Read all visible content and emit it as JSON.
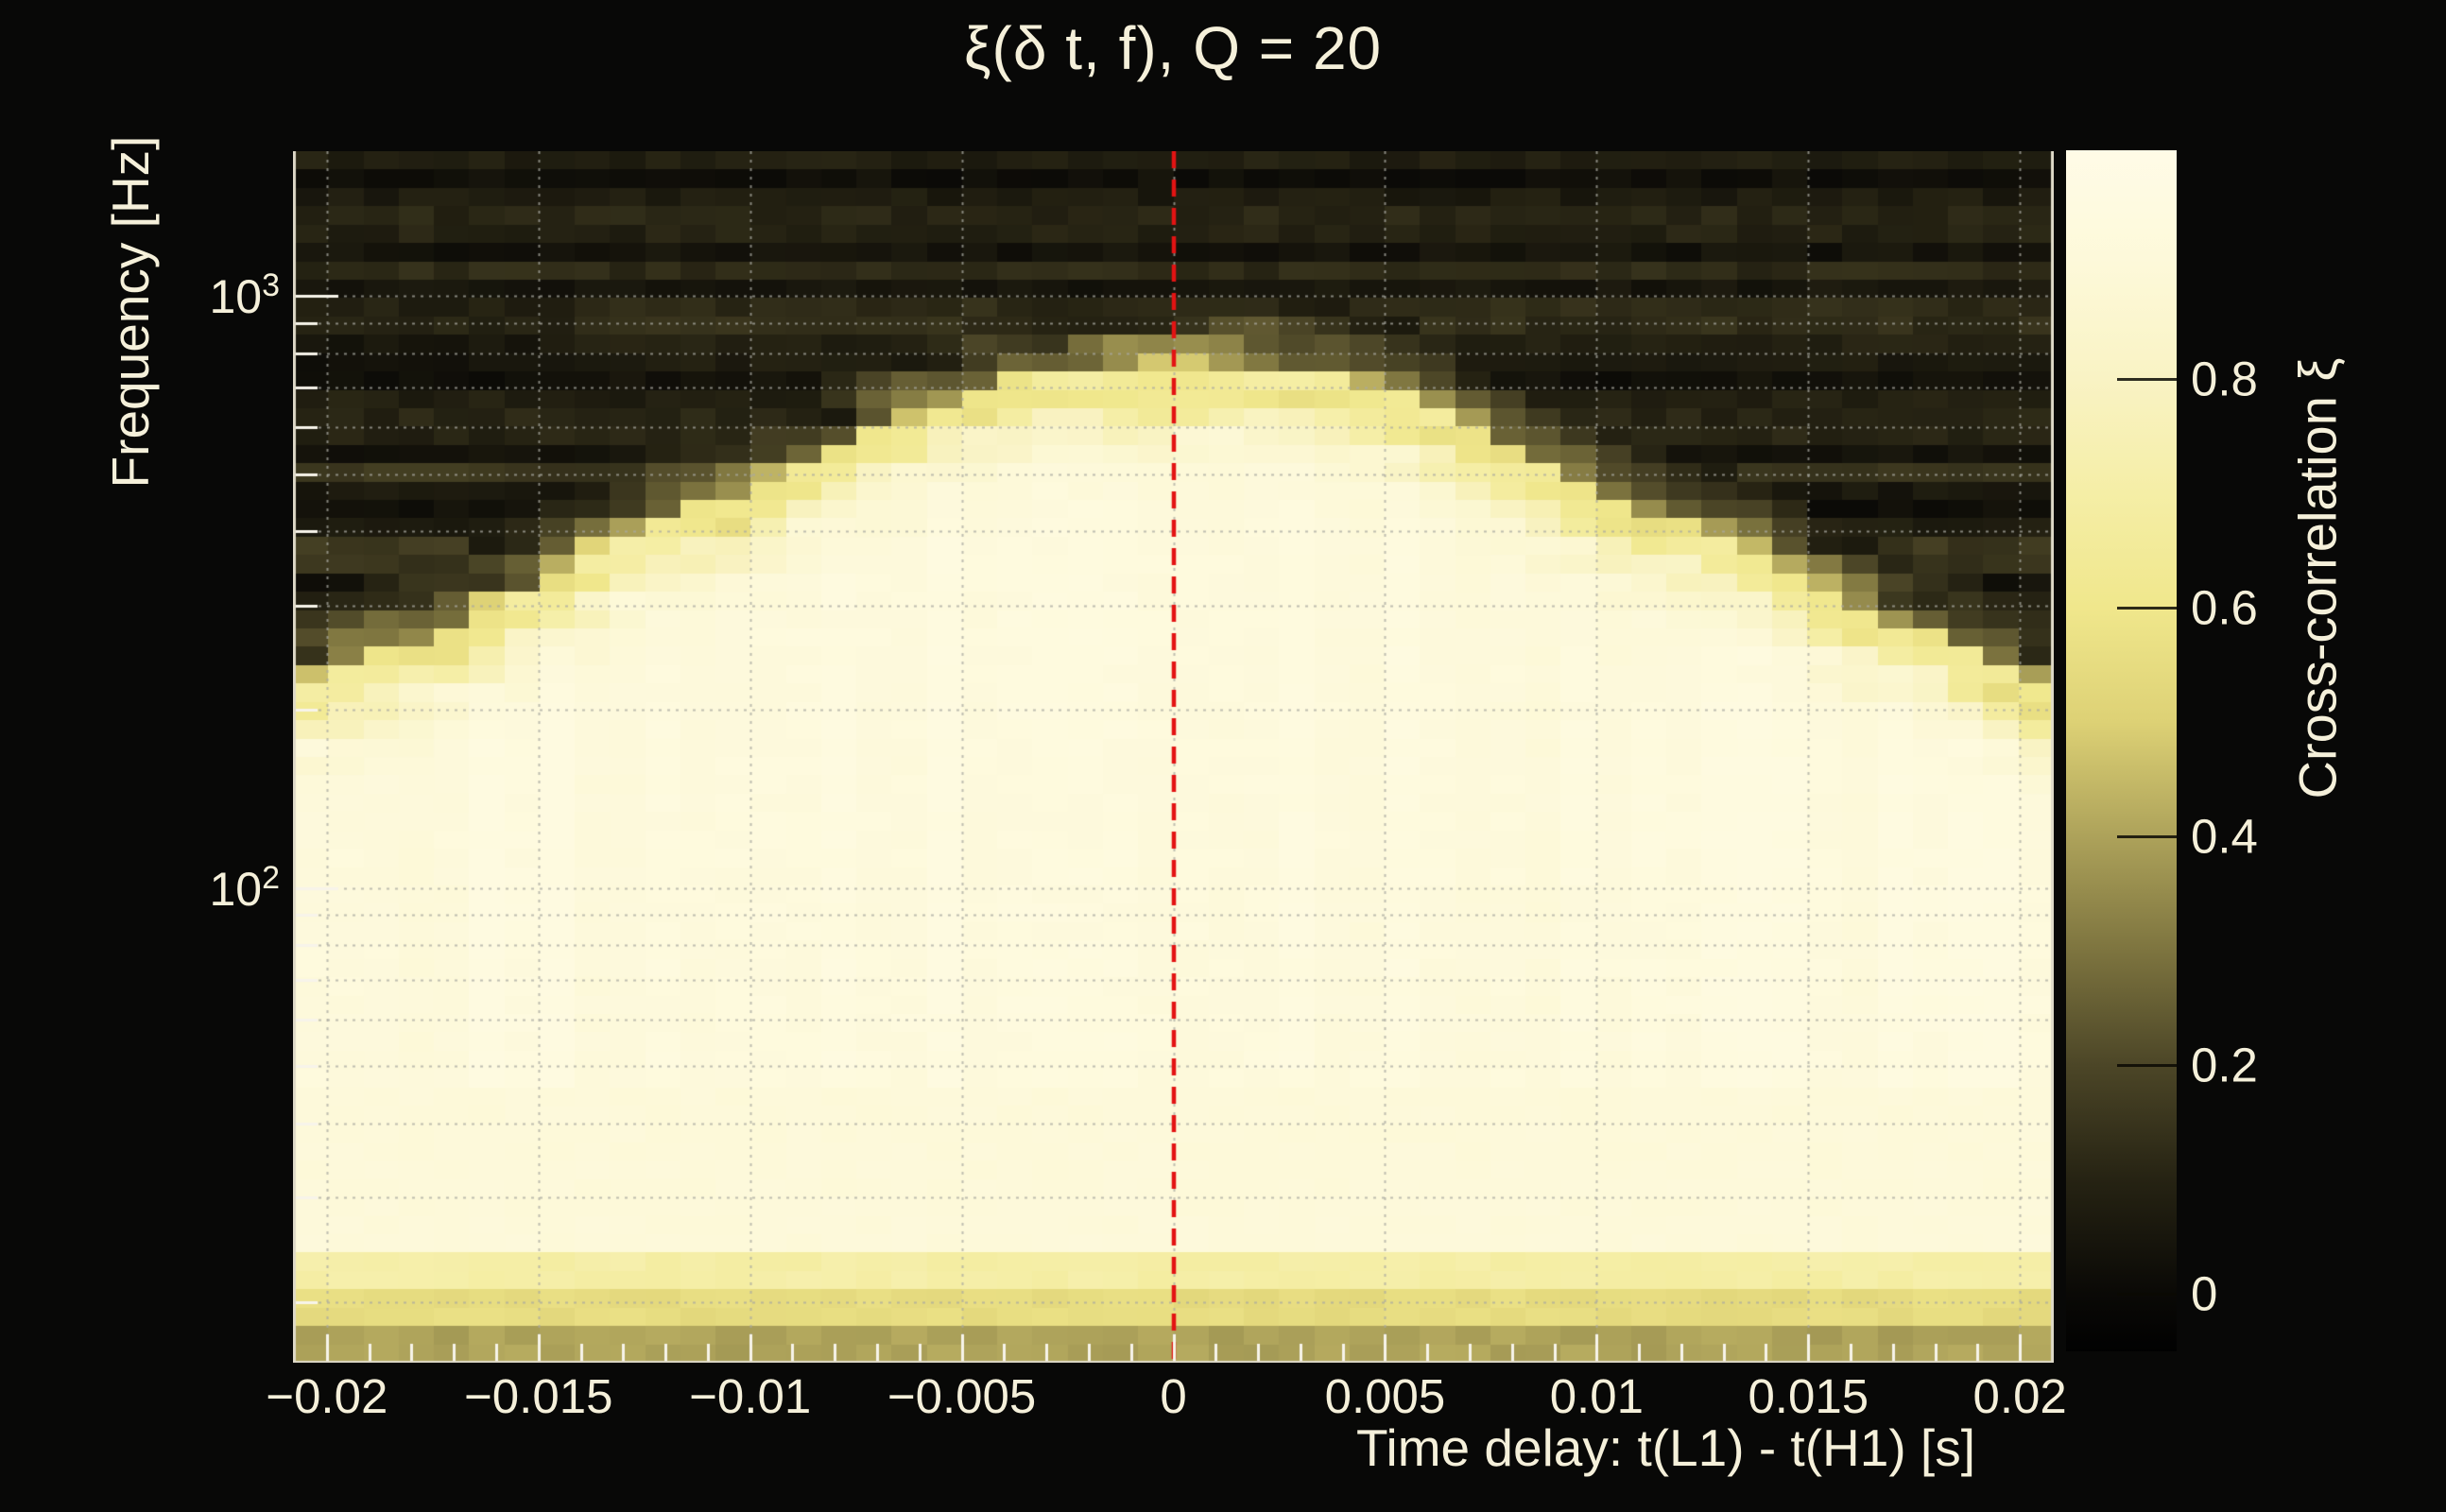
{
  "title": "ξ(δ t, f), Q = 20",
  "axes": {
    "ylabel": "Frequency [Hz]",
    "xlabel": "Time delay: t(L1) - t(H1) [s]",
    "x_ticks": [
      {
        "v": -0.02,
        "label": "−0.02"
      },
      {
        "v": -0.015,
        "label": "−0.015"
      },
      {
        "v": -0.01,
        "label": "−0.01"
      },
      {
        "v": -0.005,
        "label": "−0.005"
      },
      {
        "v": 0,
        "label": "0"
      },
      {
        "v": 0.005,
        "label": "0.005"
      },
      {
        "v": 0.01,
        "label": "0.01"
      },
      {
        "v": 0.015,
        "label": "0.015"
      },
      {
        "v": 0.02,
        "label": "0.02"
      }
    ],
    "y_ticks": [
      {
        "v": 1000,
        "base": "10",
        "exp": "3"
      },
      {
        "v": 100,
        "base": "10",
        "exp": "2"
      }
    ]
  },
  "colorbar": {
    "label": "Cross-correlation ξ",
    "vmin": -0.05,
    "vmax": 1.0,
    "ticks": [
      {
        "v": 0,
        "label": "0"
      },
      {
        "v": 0.2,
        "label": "0.2"
      },
      {
        "v": 0.4,
        "label": "0.4"
      },
      {
        "v": 0.6,
        "label": "0.6"
      },
      {
        "v": 0.8,
        "label": "0.8"
      }
    ]
  },
  "chart_data": {
    "type": "heatmap",
    "title": "ξ(δ t, f), Q = 20",
    "xlabel": "Time delay: t(L1) - t(H1) [s]",
    "ylabel": "Frequency [Hz]",
    "colorbar_label": "Cross-correlation ξ",
    "x_range_s": [
      -0.0208,
      0.0208
    ],
    "y_range_hz": [
      15.8,
      1754
    ],
    "y_scale": "log",
    "colorbar_range": [
      -0.05,
      1.0
    ],
    "colorbar_ticks": [
      0,
      0.2,
      0.4,
      0.6,
      0.8
    ],
    "x_gridlines_s": [
      -0.02,
      -0.015,
      -0.01,
      -0.005,
      0,
      0.005,
      0.01,
      0.015,
      0.02
    ],
    "y_gridlines_hz": [
      20,
      30,
      40,
      50,
      60,
      70,
      80,
      90,
      100,
      200,
      300,
      400,
      500,
      600,
      700,
      800,
      900,
      1000
    ],
    "x_minor_tick_step_s": 0.001,
    "marker_line": {
      "x_s": 0,
      "style": "dashed",
      "color": "#e31313"
    },
    "bright_region_xi": 0.93,
    "dark_region_xi": 0.05,
    "bottom_bands": [
      {
        "f_max_hz": 18.5,
        "xi": 0.4
      },
      {
        "f_max_hz": 21.0,
        "xi": 0.55
      },
      {
        "f_max_hz": 24.0,
        "xi": 0.7
      }
    ],
    "edge_profile": [
      {
        "dt": -0.0208,
        "f": 215
      },
      {
        "dt": -0.0175,
        "f": 265
      },
      {
        "dt": -0.015,
        "f": 320
      },
      {
        "dt": -0.0125,
        "f": 395
      },
      {
        "dt": -0.01,
        "f": 465
      },
      {
        "dt": -0.0075,
        "f": 555
      },
      {
        "dt": -0.006,
        "f": 615
      },
      {
        "dt": -0.005,
        "f": 680
      },
      {
        "dt": -0.004,
        "f": 718
      },
      {
        "dt": -0.002,
        "f": 735
      },
      {
        "dt": 0.0,
        "f": 740
      },
      {
        "dt": 0.002,
        "f": 735
      },
      {
        "dt": 0.004,
        "f": 722
      },
      {
        "dt": 0.005,
        "f": 688
      },
      {
        "dt": 0.0065,
        "f": 600
      },
      {
        "dt": 0.0075,
        "f": 545
      },
      {
        "dt": 0.01,
        "f": 450
      },
      {
        "dt": 0.0125,
        "f": 388
      },
      {
        "dt": 0.015,
        "f": 325
      },
      {
        "dt": 0.0175,
        "f": 268
      },
      {
        "dt": 0.0208,
        "f": 212
      }
    ],
    "grid_dt_s": [
      -0.02,
      -0.0175,
      -0.015,
      -0.0125,
      -0.01,
      -0.0075,
      -0.005,
      -0.0025,
      0,
      0.0025,
      0.005,
      0.0075,
      0.01,
      0.0125,
      0.015,
      0.0175,
      0.02
    ],
    "grid_f_hz": [
      1500,
      1000,
      700,
      500,
      350,
      250,
      150,
      80,
      40,
      20
    ],
    "xi_grid": [
      [
        0.05,
        0.05,
        0.05,
        0.05,
        0.05,
        0.05,
        0.05,
        0.05,
        0.05,
        0.05,
        0.05,
        0.05,
        0.05,
        0.05,
        0.05,
        0.05,
        0.05
      ],
      [
        0.05,
        0.05,
        0.05,
        0.05,
        0.05,
        0.05,
        0.05,
        0.06,
        0.06,
        0.06,
        0.05,
        0.05,
        0.05,
        0.05,
        0.05,
        0.05,
        0.05
      ],
      [
        0.04,
        0.04,
        0.04,
        0.05,
        0.06,
        0.22,
        0.48,
        0.68,
        0.72,
        0.68,
        0.5,
        0.2,
        0.06,
        0.05,
        0.04,
        0.04,
        0.04
      ],
      [
        0.04,
        0.05,
        0.06,
        0.21,
        0.42,
        0.78,
        0.9,
        0.92,
        0.93,
        0.92,
        0.9,
        0.76,
        0.38,
        0.2,
        0.07,
        0.05,
        0.04
      ],
      [
        0.06,
        0.18,
        0.4,
        0.78,
        0.89,
        0.92,
        0.93,
        0.93,
        0.93,
        0.93,
        0.92,
        0.92,
        0.88,
        0.77,
        0.42,
        0.19,
        0.06
      ],
      [
        0.35,
        0.72,
        0.88,
        0.92,
        0.93,
        0.93,
        0.93,
        0.94,
        0.94,
        0.94,
        0.93,
        0.93,
        0.92,
        0.92,
        0.88,
        0.73,
        0.33
      ],
      [
        0.9,
        0.92,
        0.93,
        0.93,
        0.94,
        0.94,
        0.94,
        0.94,
        0.94,
        0.94,
        0.94,
        0.94,
        0.93,
        0.93,
        0.93,
        0.92,
        0.89
      ],
      [
        0.94,
        0.94,
        0.94,
        0.94,
        0.94,
        0.94,
        0.94,
        0.94,
        0.94,
        0.94,
        0.94,
        0.94,
        0.94,
        0.94,
        0.94,
        0.94,
        0.94
      ],
      [
        0.9,
        0.9,
        0.91,
        0.91,
        0.91,
        0.91,
        0.91,
        0.91,
        0.91,
        0.91,
        0.91,
        0.91,
        0.91,
        0.91,
        0.91,
        0.9,
        0.9
      ],
      [
        0.52,
        0.52,
        0.52,
        0.52,
        0.52,
        0.52,
        0.52,
        0.52,
        0.52,
        0.52,
        0.52,
        0.52,
        0.52,
        0.52,
        0.52,
        0.52,
        0.52
      ]
    ],
    "colormap": [
      {
        "v": -0.05,
        "c": "#010101"
      },
      {
        "v": 0.0,
        "c": "#0a0906"
      },
      {
        "v": 0.1,
        "c": "#262313"
      },
      {
        "v": 0.2,
        "c": "#4c4627"
      },
      {
        "v": 0.3,
        "c": "#7d743f"
      },
      {
        "v": 0.4,
        "c": "#ada25a"
      },
      {
        "v": 0.5,
        "c": "#ddd175"
      },
      {
        "v": 0.6,
        "c": "#f0e78c"
      },
      {
        "v": 0.7,
        "c": "#f5eea6"
      },
      {
        "v": 0.8,
        "c": "#f9f3c4"
      },
      {
        "v": 0.9,
        "c": "#fdf9d9"
      },
      {
        "v": 1.0,
        "c": "#fffbe7"
      }
    ]
  },
  "layout_colors": {
    "background": "#080807",
    "text": "#f5f0da",
    "grid": "#9a9a92",
    "frame": "#ded9c8",
    "tick": "#f7f4ea"
  }
}
